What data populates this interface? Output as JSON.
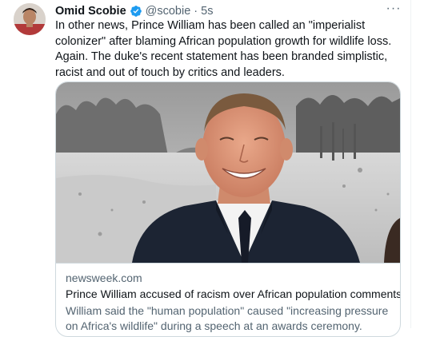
{
  "tweet": {
    "display_name": "Omid Scobie",
    "handle": "@scobie",
    "separator": "·",
    "time": "5s",
    "more_glyph": "···",
    "text": "In other news, Prince William has been called an \"imperialist colonizer\" after blaming African population growth for wildlife loss. Again. The duke's recent statement has been branded simplistic, racist and out of touch by critics and leaders."
  },
  "card": {
    "domain": "newsweek.com",
    "title": "Prince William accused of racism over African population comments",
    "description": "William said the \"human population\" caused \"increasing pressure on Africa's wildlife\" during a speech at an awards ceremony."
  },
  "colors": {
    "verified": "#1d9bf0",
    "secondary_text": "#536471",
    "border": "#cfd9de"
  },
  "icons": {
    "verified": "verified-badge-icon",
    "more": "more-options-icon"
  }
}
